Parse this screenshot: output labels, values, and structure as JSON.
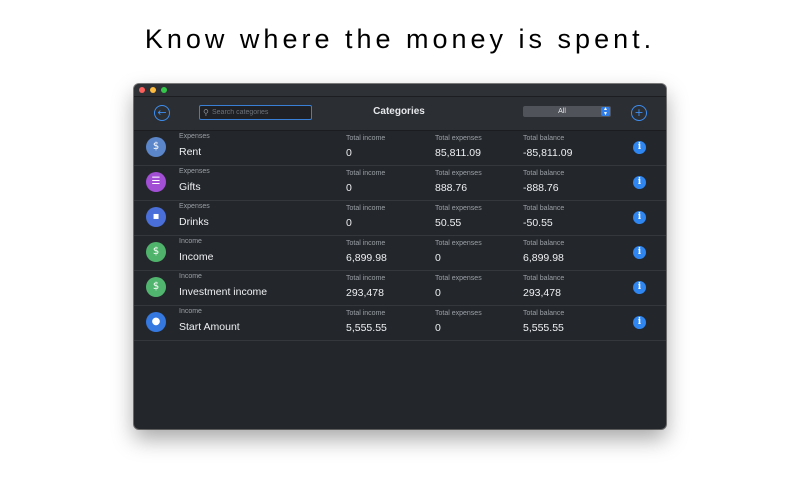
{
  "headline": "Know where the money is spent.",
  "toolbar": {
    "back_icon": "←",
    "search_placeholder": "Search categories",
    "search_value": "",
    "title": "Categories",
    "filter_value": "All",
    "add_icon": "+"
  },
  "columns": {
    "income": "Total income",
    "expenses": "Total expenses",
    "balance": "Total balance"
  },
  "rows": [
    {
      "kind": "Expenses",
      "name": "Rent",
      "income": "0",
      "expenses": "85,811.09",
      "balance": "-85,811.09",
      "icon": "house-dollar-icon",
      "glyph": "$",
      "color": "#5b86c9"
    },
    {
      "kind": "Expenses",
      "name": "Gifts",
      "income": "0",
      "expenses": "888.76",
      "balance": "-888.76",
      "icon": "gift-icon",
      "glyph": "☰",
      "color": "#a24fd6"
    },
    {
      "kind": "Expenses",
      "name": "Drinks",
      "income": "0",
      "expenses": "50.55",
      "balance": "-50.55",
      "icon": "drink-cup-icon",
      "glyph": "▪",
      "color": "#4a6fd8"
    },
    {
      "kind": "Income",
      "name": "Income",
      "income": "6,899.98",
      "expenses": "0",
      "balance": "6,899.98",
      "icon": "cash-icon",
      "glyph": "$",
      "color": "#4fb36b"
    },
    {
      "kind": "Income",
      "name": "Investment income",
      "income": "293,478",
      "expenses": "0",
      "balance": "293,478",
      "icon": "money-stack-icon",
      "glyph": "$",
      "color": "#52b56f"
    },
    {
      "kind": "Income",
      "name": "Start Amount",
      "income": "5,555.55",
      "expenses": "0",
      "balance": "5,555.55",
      "icon": "piggy-bank-icon",
      "glyph": "●",
      "color": "#3578e0"
    }
  ],
  "info_glyph": "i",
  "colors": {
    "accent": "#2f86f0",
    "window_bg": "#23262b"
  }
}
